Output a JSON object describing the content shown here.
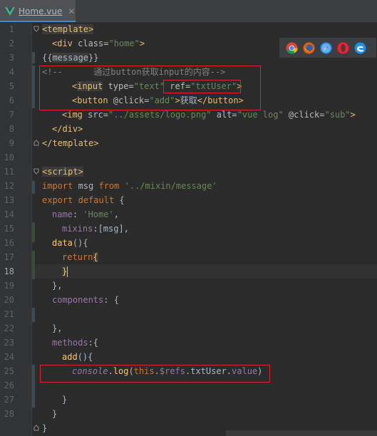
{
  "tab": {
    "filename": "Home.vue",
    "close": "✕"
  },
  "line_numbers": [
    "1",
    "2",
    "3",
    "4",
    "5",
    "6",
    "7",
    "8",
    "9",
    "10",
    "11",
    "12",
    "13",
    "14",
    "15",
    "16",
    "17",
    "18",
    "19",
    "20",
    "21",
    "22",
    "23",
    "24",
    "25",
    "26",
    "27",
    "28"
  ],
  "current_line": "18",
  "code": {
    "l1": {
      "open": "<template>"
    },
    "l2": {
      "tag_open": "<div ",
      "attr": "class=",
      "val": "\"home\"",
      "close": ">"
    },
    "l3": {
      "a": "{{",
      "var": "message",
      "b": "}}"
    },
    "l4": {
      "comment": "<!--      通过button获取input的内容-->"
    },
    "l5": {
      "lt": "<",
      "tag": "input",
      "attr": " type=",
      "val": "\"text\"",
      "attr2": " ref=",
      "val2": "\"txtUser\"",
      "gt": ">"
    },
    "l6": {
      "tag": "<button ",
      "attr": "@click=",
      "val": "\"add\"",
      "gt": ">",
      "text": "获取",
      "close": "</button>"
    },
    "l7": {
      "tag": "<img ",
      "attr1": "src=",
      "val1": "\"../assets/logo.png\"",
      "attr2": " alt=",
      "val2": "\"vue log\"",
      "attr3": " @click=",
      "val3": "\"sub\"",
      "gt": ">"
    },
    "l8": {
      "close": "</div>"
    },
    "l9": {
      "close": "</template>"
    },
    "l11": {
      "open": "<script>"
    },
    "l12": {
      "kw1": "import",
      "name": " msg ",
      "kw2": "from",
      "sp": " ",
      "str": "'../mixin/message'"
    },
    "l13": {
      "kw1": "export",
      "sp": " ",
      "kw2": "default",
      "rest": " {"
    },
    "l14": {
      "prop": "name",
      "colon": ": ",
      "str": "'Home'",
      "comma": ","
    },
    "l15": {
      "prop": "mixins",
      "rest": ":[msg],"
    },
    "l16": {
      "fn": "data",
      "rest": "(){"
    },
    "l17": {
      "kw": "return",
      "brace": "{"
    },
    "l18": {
      "brace": "}"
    },
    "l19": {
      "text": "},"
    },
    "l20": {
      "prop": "components",
      "rest": ": {"
    },
    "l22": {
      "text": "},"
    },
    "l23": {
      "prop": "methods",
      "rest": ":{"
    },
    "l24": {
      "fn": "add",
      "rest": "(){"
    },
    "l25": {
      "obj": "console",
      "dot": ".",
      "fn": "log",
      "p1": "(",
      "kw": "this",
      "p2": ".",
      "refs": "$refs",
      "p3": ".txtUser.",
      "val": "value",
      "p4": ")"
    },
    "l27": {
      "text": "}"
    },
    "l28": {
      "text": "}"
    },
    "l29": {
      "text": "}"
    }
  },
  "browsers": [
    "chrome-icon",
    "firefox-icon",
    "safari-icon",
    "opera-icon",
    "edge-icon"
  ],
  "colors": {
    "highlight_box": "#d9262c",
    "tab_underline": "#4a88c7",
    "change_bar": "#384c38"
  }
}
